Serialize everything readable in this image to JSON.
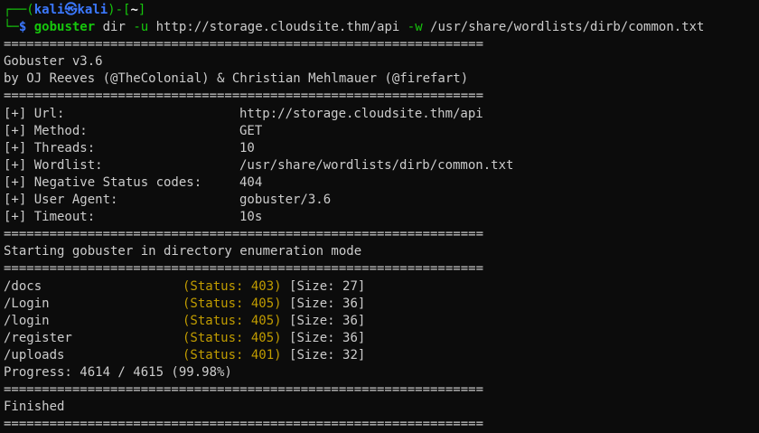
{
  "prompt": {
    "corner_top": "┌──(",
    "user": "kali",
    "at": "㉿",
    "host": "kali",
    "mid": ")-[",
    "dir": "~",
    "close": "]",
    "corner_bottom": "└─",
    "dollar": "$"
  },
  "command": {
    "program": "gobuster",
    "args": [
      {
        "text": " dir ",
        "style": "plain"
      },
      {
        "text": "-u",
        "style": "flag"
      },
      {
        "text": " http://storage.cloudsite.thm/api ",
        "style": "plain"
      },
      {
        "text": "-w",
        "style": "flag"
      },
      {
        "text": " /usr/share/wordlists/dirb/common.txt",
        "style": "plain"
      }
    ]
  },
  "separator": "===============================================================",
  "banner": {
    "title": "Gobuster v3.6",
    "authors": "by OJ Reeves (@TheColonial) & Christian Mehlmauer (@firefart)"
  },
  "config": [
    {
      "label": "[+] Url:",
      "value": "http://storage.cloudsite.thm/api"
    },
    {
      "label": "[+] Method:",
      "value": "GET"
    },
    {
      "label": "[+] Threads:",
      "value": "10"
    },
    {
      "label": "[+] Wordlist:",
      "value": "/usr/share/wordlists/dirb/common.txt"
    },
    {
      "label": "[+] Negative Status codes:",
      "value": "404"
    },
    {
      "label": "[+] User Agent:",
      "value": "gobuster/3.6"
    },
    {
      "label": "[+] Timeout:",
      "value": "10s"
    }
  ],
  "mode_text": "Starting gobuster in directory enumeration mode",
  "results": [
    {
      "path": "/docs",
      "status": "(Status: 403)",
      "size": "[Size: 27]"
    },
    {
      "path": "/Login",
      "status": "(Status: 405)",
      "size": "[Size: 36]"
    },
    {
      "path": "/login",
      "status": "(Status: 405)",
      "size": "[Size: 36]"
    },
    {
      "path": "/register",
      "status": "(Status: 405)",
      "size": "[Size: 36]"
    },
    {
      "path": "/uploads",
      "status": "(Status: 401)",
      "size": "[Size: 32]"
    }
  ],
  "progress": "Progress: 4614 / 4615 (99.98%)",
  "finished": "Finished",
  "colors": {
    "background": "#0c0c0c",
    "text": "#cccccc",
    "prompt_blue": "#3b78ff",
    "prompt_green": "#16c60c",
    "status_yellow": "#c19c00"
  }
}
